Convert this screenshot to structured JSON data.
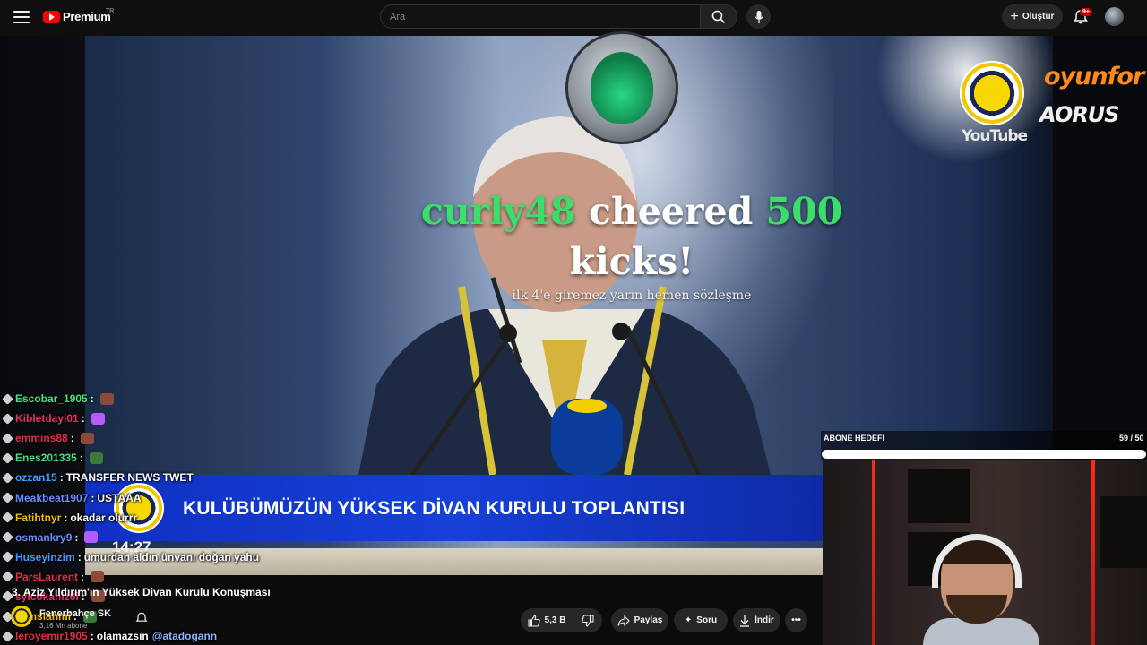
{
  "header": {
    "brand": "Premium",
    "brand_region": "TR",
    "search_placeholder": "Ara",
    "create_label": "Oluştur",
    "notifications_badge": "9+"
  },
  "stream": {
    "alert": {
      "username": "curly48",
      "verb": " cheered ",
      "amount": "500",
      "unit": "kicks!",
      "message": "ilk 4'e giremez yarın hemen sözleşme"
    },
    "sponsors": {
      "club_label": "YouTube",
      "sponsor1": "oyunfor",
      "sponsor2": "AORUS"
    },
    "lower_third": {
      "title": "KULÜBÜMÜZÜN YÜKSEK DİVAN KURULU TOPLANTISI",
      "time": "14:27"
    }
  },
  "chat": [
    {
      "user": "Escobar_1905",
      "color": "#4ade80",
      "msg": "",
      "emote": "#8b4a3a"
    },
    {
      "user": "Kibletdayi01",
      "color": "#e0356a",
      "msg": "",
      "emote": "#b45cff"
    },
    {
      "user": "emmins88",
      "color": "#d9334a",
      "msg": "",
      "emote": "#8b4a3a"
    },
    {
      "user": "Enes201335",
      "color": "#4ade80",
      "msg": "",
      "emote": "#3a7a3a"
    },
    {
      "user": "ozzan15",
      "color": "#3aa0ff",
      "msg": "TRANSFER NEWS TWET",
      "emote": ""
    },
    {
      "user": "Meakbeat1907",
      "color": "#6c8cff",
      "msg": "USTAAA",
      "emote": ""
    },
    {
      "user": "Fatihtnyr",
      "color": "#f0c000",
      "msg": "okadar olurrr",
      "emote": ""
    },
    {
      "user": "osmankry9",
      "color": "#6c8cff",
      "msg": "",
      "emote": "#b45cff"
    },
    {
      "user": "Huseyinzim",
      "color": "#3aa0ff",
      "msg": "umurdan aldın ünvanı doğan yahu",
      "emote": ""
    },
    {
      "user": "ParsLaurent",
      "color": "#d9334a",
      "msg": "",
      "emote": "#8b4a3a"
    },
    {
      "user": "sylcokaniz6i",
      "color": "#e0356a",
      "msg": "",
      "emote": "#8b4a3a"
    },
    {
      "user": "semsiahmi",
      "color": "#f0c000",
      "msg": "",
      "emote": "#3a7a3a"
    },
    {
      "user": "leroyemir1905",
      "color": "#d9334a",
      "msg": "olamazsın",
      "mention": "@atadogann",
      "emote": ""
    }
  ],
  "video": {
    "title": "3. Aziz Yıldırım'ın Yüksek Divan Kurulu Konuşması",
    "channel_name": "Fenerbahçe SK",
    "channel_subs": "3,16 Mn abone"
  },
  "actions": {
    "likes": "5,3 B",
    "share": "Paylaş",
    "ask": "Soru",
    "download": "İndir"
  },
  "goal": {
    "label": "ABONE HEDEFİ",
    "count": "59 / 50",
    "progress": 1.0
  },
  "colors": {
    "accent_red": "#ff0000",
    "lower_third_blue": "#1640d8",
    "alert_green": "#3bde6a"
  }
}
